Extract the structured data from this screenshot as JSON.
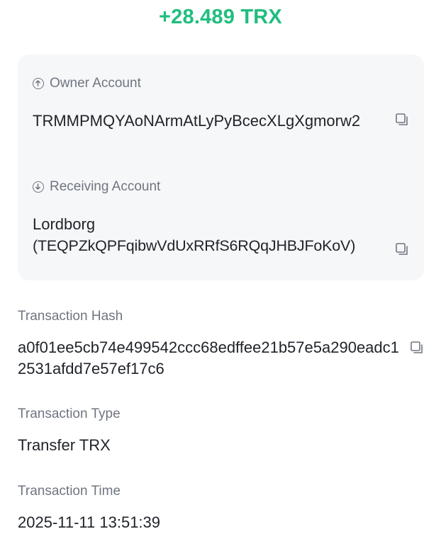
{
  "amount": "+28.489 TRX",
  "owner": {
    "label": "Owner Account",
    "address": "TRMMPMQYAoNArmAtLyPyBcecXLgXgmorw2"
  },
  "receiver": {
    "label": "Receiving Account",
    "name": "Lordborg",
    "address": "(TEQPZkQPFqibwVdUxRRfS6RQqJHBJFoKoV)"
  },
  "tx_hash": {
    "label": "Transaction Hash",
    "value": "a0f01ee5cb74e499542ccc68edffee21b57e5a290eadc12531afdd7e57ef17c6"
  },
  "tx_type": {
    "label": "Transaction Type",
    "value": "Transfer TRX"
  },
  "tx_time": {
    "label": "Transaction Time",
    "value": "2025-11-11 13:51:39"
  },
  "colors": {
    "amount": "#1fbe7e",
    "label": "#6f7580",
    "text": "#1f2329",
    "card_bg": "#f6f7f9"
  },
  "icons": {
    "owner": "arrow-up-circle-icon",
    "receiver": "arrow-down-circle-icon",
    "copy": "copy-icon"
  }
}
